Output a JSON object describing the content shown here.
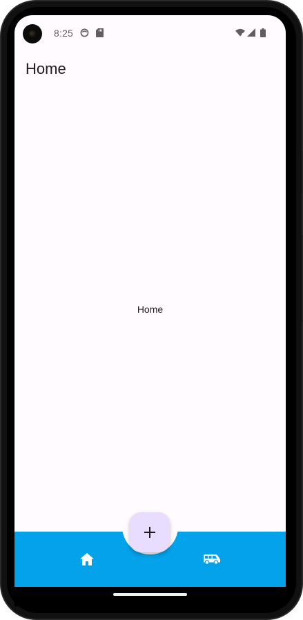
{
  "status_bar": {
    "time": "8:25",
    "left_icons": [
      "face-notification-icon",
      "sd-card-icon"
    ],
    "right_icons": [
      "wifi-icon",
      "signal-icon",
      "battery-icon"
    ]
  },
  "app_bar": {
    "title": "Home"
  },
  "content": {
    "center_text": "Home"
  },
  "fab": {
    "icon": "plus-icon",
    "glyph": "+"
  },
  "bottom_nav": {
    "items": [
      {
        "icon": "home-icon"
      },
      {
        "icon": "van-icon"
      }
    ]
  },
  "colors": {
    "background": "#fffbfe",
    "bottom_bar": "#03a2ea",
    "fab": "#e9ddff",
    "text": "#1c1b1f"
  }
}
